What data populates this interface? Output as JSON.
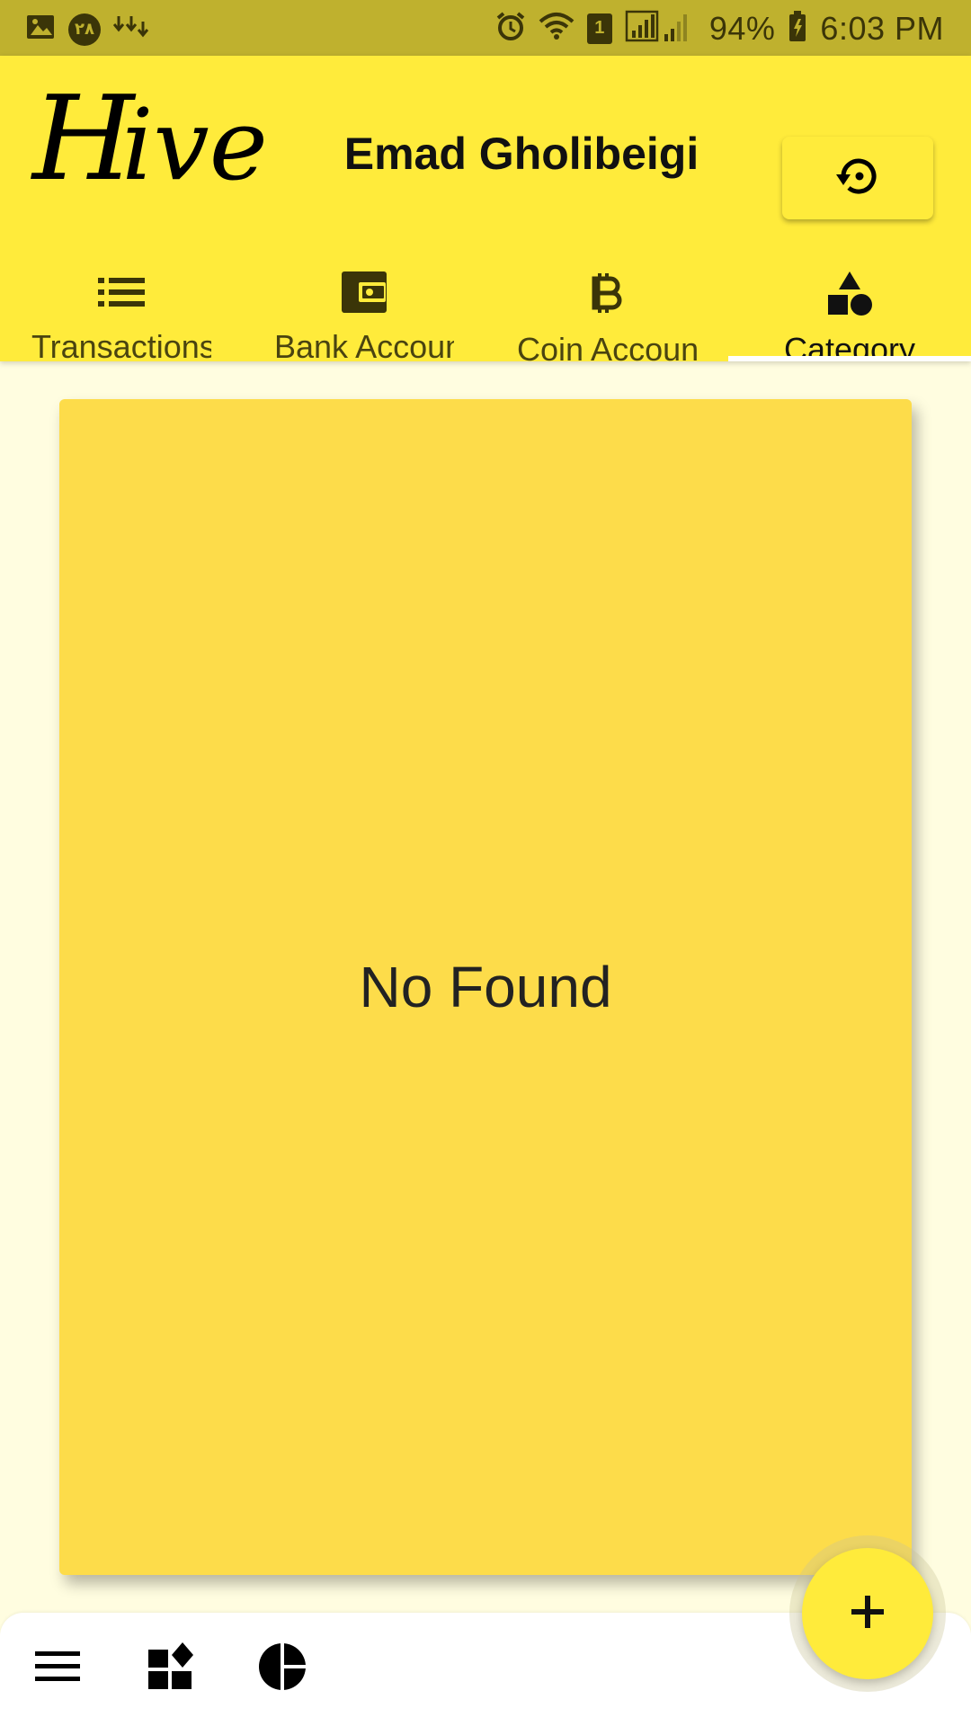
{
  "status_bar": {
    "date_badge": "۲۸",
    "battery_percent": "94%",
    "time": "6:03 PM",
    "sim_label": "1",
    "icons": [
      "gallery-icon",
      "download-icon",
      "alarm-icon",
      "wifi-icon",
      "signal-icon",
      "battery-icon"
    ]
  },
  "header": {
    "logo_big": "H",
    "logo_small": "ive",
    "user_name": "Emad Gholibeigi",
    "refresh_icon": "restore-icon"
  },
  "tabs": [
    {
      "label": "Transactions",
      "icon": "list-icon",
      "active": false
    },
    {
      "label": "Bank Accounts",
      "icon": "wallet-icon",
      "active": false
    },
    {
      "label": "Coin Accounts",
      "icon": "bitcoin-icon",
      "active": false
    },
    {
      "label": "Category",
      "icon": "shapes-icon",
      "active": true
    }
  ],
  "main": {
    "empty_message": "No Found"
  },
  "bottom_nav": {
    "items": [
      "menu-icon",
      "widgets-icon",
      "pie-chart-icon"
    ]
  },
  "fab": {
    "label": "+"
  },
  "colors": {
    "status_bar": "#BFB12E",
    "header": "#FFEB3B",
    "card": "#FDDC4A",
    "background": "#FFFDE0"
  }
}
